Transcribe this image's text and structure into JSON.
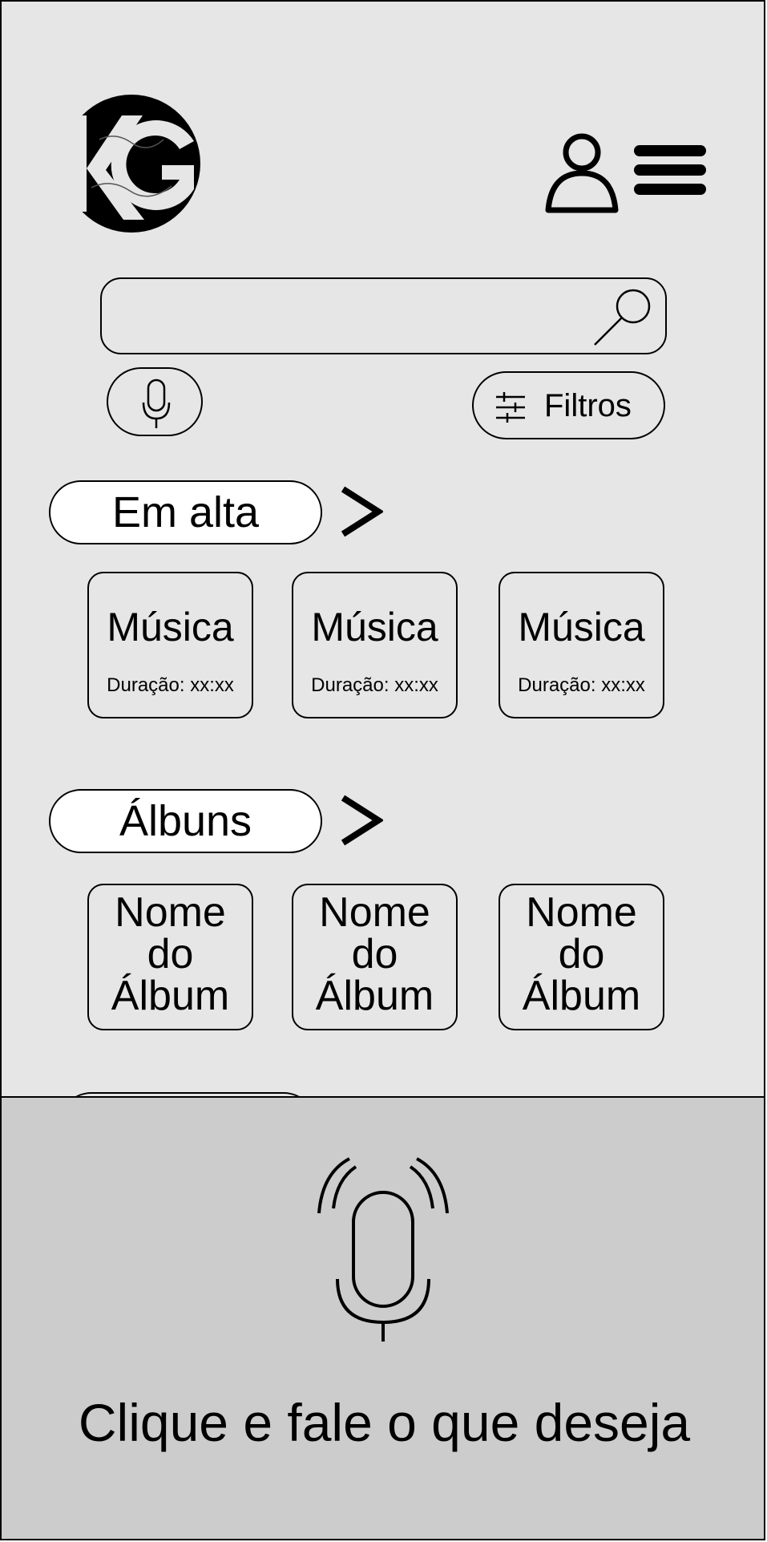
{
  "header": {
    "logo_text": "KG",
    "user_icon": "user-icon",
    "menu_icon": "hamburger-menu-icon"
  },
  "search": {
    "value": "",
    "placeholder": "",
    "icon": "search-icon"
  },
  "mic_button": {
    "icon": "microphone-icon"
  },
  "filters_button": {
    "icon": "sliders-icon",
    "label": "Filtros"
  },
  "trending": {
    "title": "Em alta",
    "arrow_icon": "chevron-right-icon",
    "items": [
      {
        "title": "Música",
        "duration": "Duração: xx:xx"
      },
      {
        "title": "Música",
        "duration": "Duração: xx:xx"
      },
      {
        "title": "Música",
        "duration": "Duração: xx:xx"
      }
    ]
  },
  "albums": {
    "title": "Álbuns",
    "arrow_icon": "chevron-right-icon",
    "items": [
      {
        "title": "Nome\ndo\nÁlbum"
      },
      {
        "title": "Nome\ndo\nÁlbum"
      },
      {
        "title": "Nome\ndo\nÁlbum"
      }
    ]
  },
  "voice_panel": {
    "icon": "microphone-listening-icon",
    "prompt": "Clique e fale o que deseja"
  },
  "colors": {
    "screen_bg": "#e6e6e6",
    "panel_bg": "#cccccc",
    "pill_bg": "#ffffff",
    "stroke": "#000000"
  }
}
